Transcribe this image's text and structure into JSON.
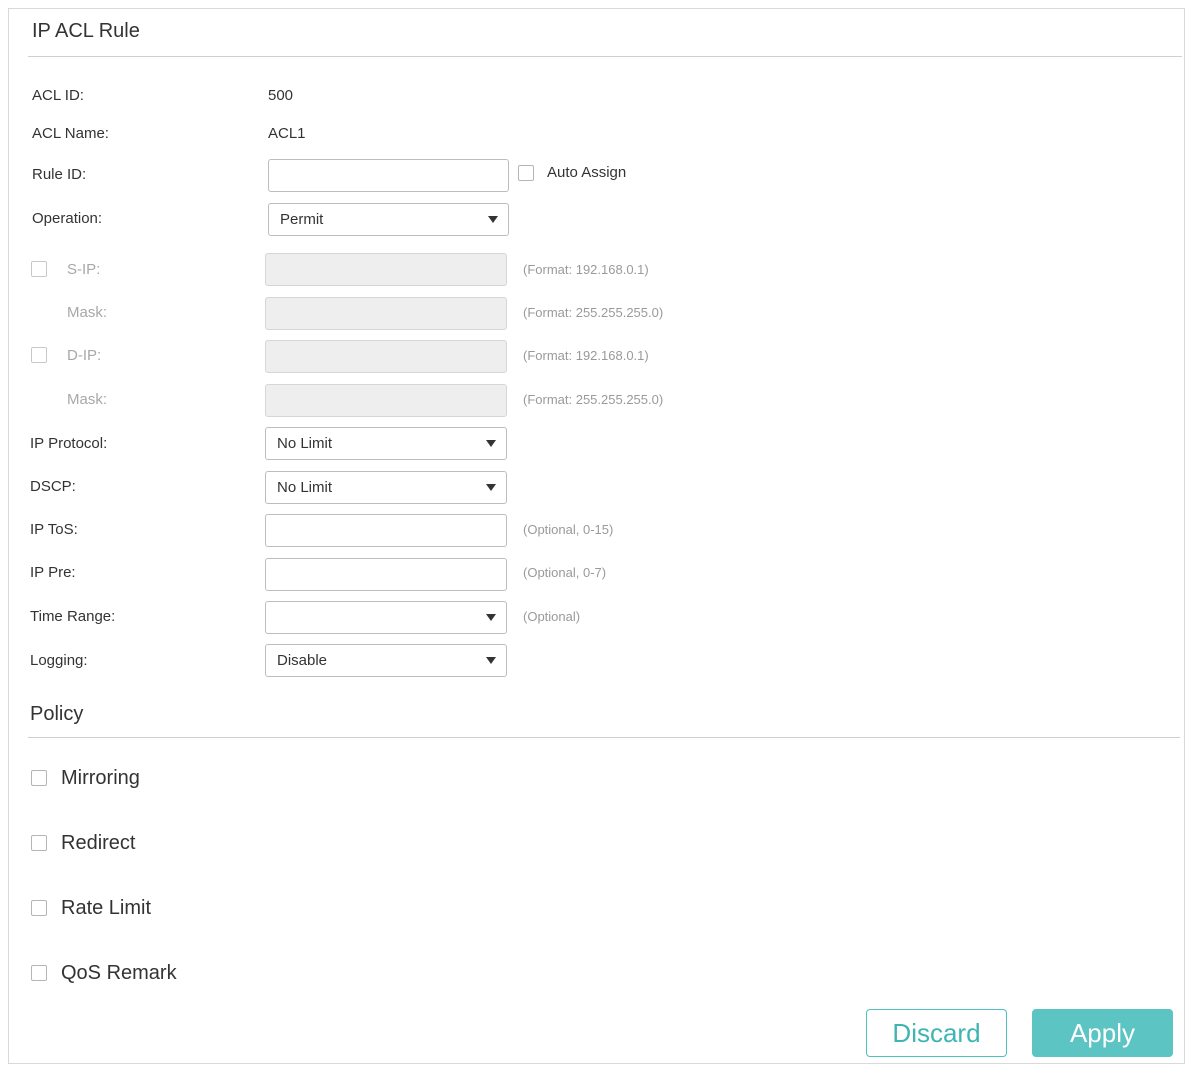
{
  "form": {
    "title": "IP ACL Rule",
    "acl_id_label": "ACL ID:",
    "acl_id_value": "500",
    "acl_name_label": "ACL Name:",
    "acl_name_value": "ACL1",
    "rule_id_label": "Rule ID:",
    "rule_id_value": "",
    "auto_assign_label": "Auto Assign",
    "auto_assign_checked": false,
    "operation_label": "Operation:",
    "operation_value": "Permit",
    "sip_label": "S-IP:",
    "sip_value": "",
    "sip_hint": "(Format: 192.168.0.1)",
    "smask_label": "Mask:",
    "smask_value": "",
    "smask_hint": "(Format: 255.255.255.0)",
    "dip_label": "D-IP:",
    "dip_value": "",
    "dip_hint": "(Format: 192.168.0.1)",
    "dmask_label": "Mask:",
    "dmask_value": "",
    "dmask_hint": "(Format: 255.255.255.0)",
    "ip_protocol_label": "IP Protocol:",
    "ip_protocol_value": "No Limit",
    "dscp_label": "DSCP:",
    "dscp_value": "No Limit",
    "ip_tos_label": "IP ToS:",
    "ip_tos_value": "",
    "ip_tos_hint": "(Optional, 0-15)",
    "ip_pre_label": "IP Pre:",
    "ip_pre_value": "",
    "ip_pre_hint": "(Optional, 0-7)",
    "time_range_label": "Time Range:",
    "time_range_value": "",
    "time_range_hint": "(Optional)",
    "logging_label": "Logging:",
    "logging_value": "Disable"
  },
  "policy": {
    "title": "Policy",
    "items": [
      {
        "label": "Mirroring",
        "checked": false
      },
      {
        "label": "Redirect",
        "checked": false
      },
      {
        "label": "Rate Limit",
        "checked": false
      },
      {
        "label": "QoS Remark",
        "checked": false
      }
    ]
  },
  "buttons": {
    "discard": "Discard",
    "apply": "Apply"
  },
  "colors": {
    "accent": "#5cc5c3",
    "accent_text": "#3fb5b3"
  },
  "icons": {
    "dropdown": "chevron-down-icon",
    "checkbox": "checkbox-icon"
  }
}
